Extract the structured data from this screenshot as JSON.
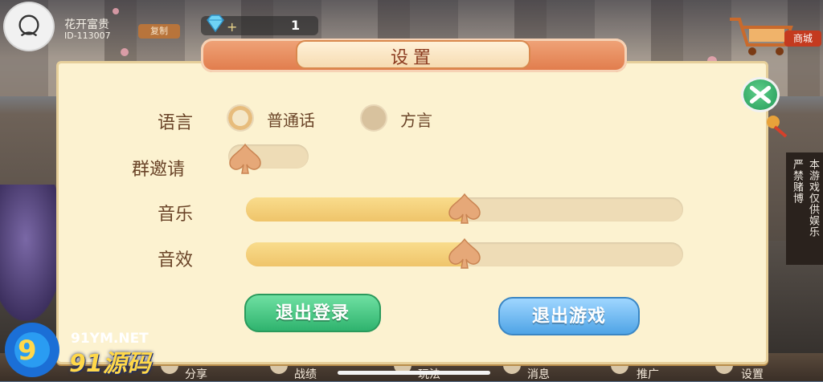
{
  "player": {
    "name": "花开富贵",
    "id": "ID-113007",
    "copy_label": "复制"
  },
  "currency": {
    "diamond_count": "1",
    "plus": "+",
    "icon": "diamond-icon"
  },
  "shop": {
    "label": "商城",
    "icon": "shopping-cart-icon"
  },
  "notice": {
    "col1": "本游戏仅供娱乐",
    "col2": "严禁赌博"
  },
  "dialog": {
    "title": "设置",
    "language": {
      "label": "语言",
      "options": [
        "普通话",
        "方言"
      ],
      "selected": "普通话"
    },
    "group_invite": {
      "label": "群邀请",
      "enabled": false
    },
    "music": {
      "label": "音乐",
      "level": 0.5
    },
    "sound": {
      "label": "音效",
      "level": 0.5
    },
    "buttons": {
      "logout": "退出登录",
      "quit": "退出游戏"
    }
  },
  "bottom_nav": [
    "分享",
    "战绩",
    "玩法",
    "消息",
    "推广",
    "设置"
  ],
  "watermark": {
    "url": "91YM.NET",
    "text": "91源码"
  },
  "colors": {
    "dialog_bg": "#fcf2d0",
    "title_orange": "#e07a4a",
    "green_button": "#2fb36e",
    "blue_button": "#4fa4e6"
  }
}
